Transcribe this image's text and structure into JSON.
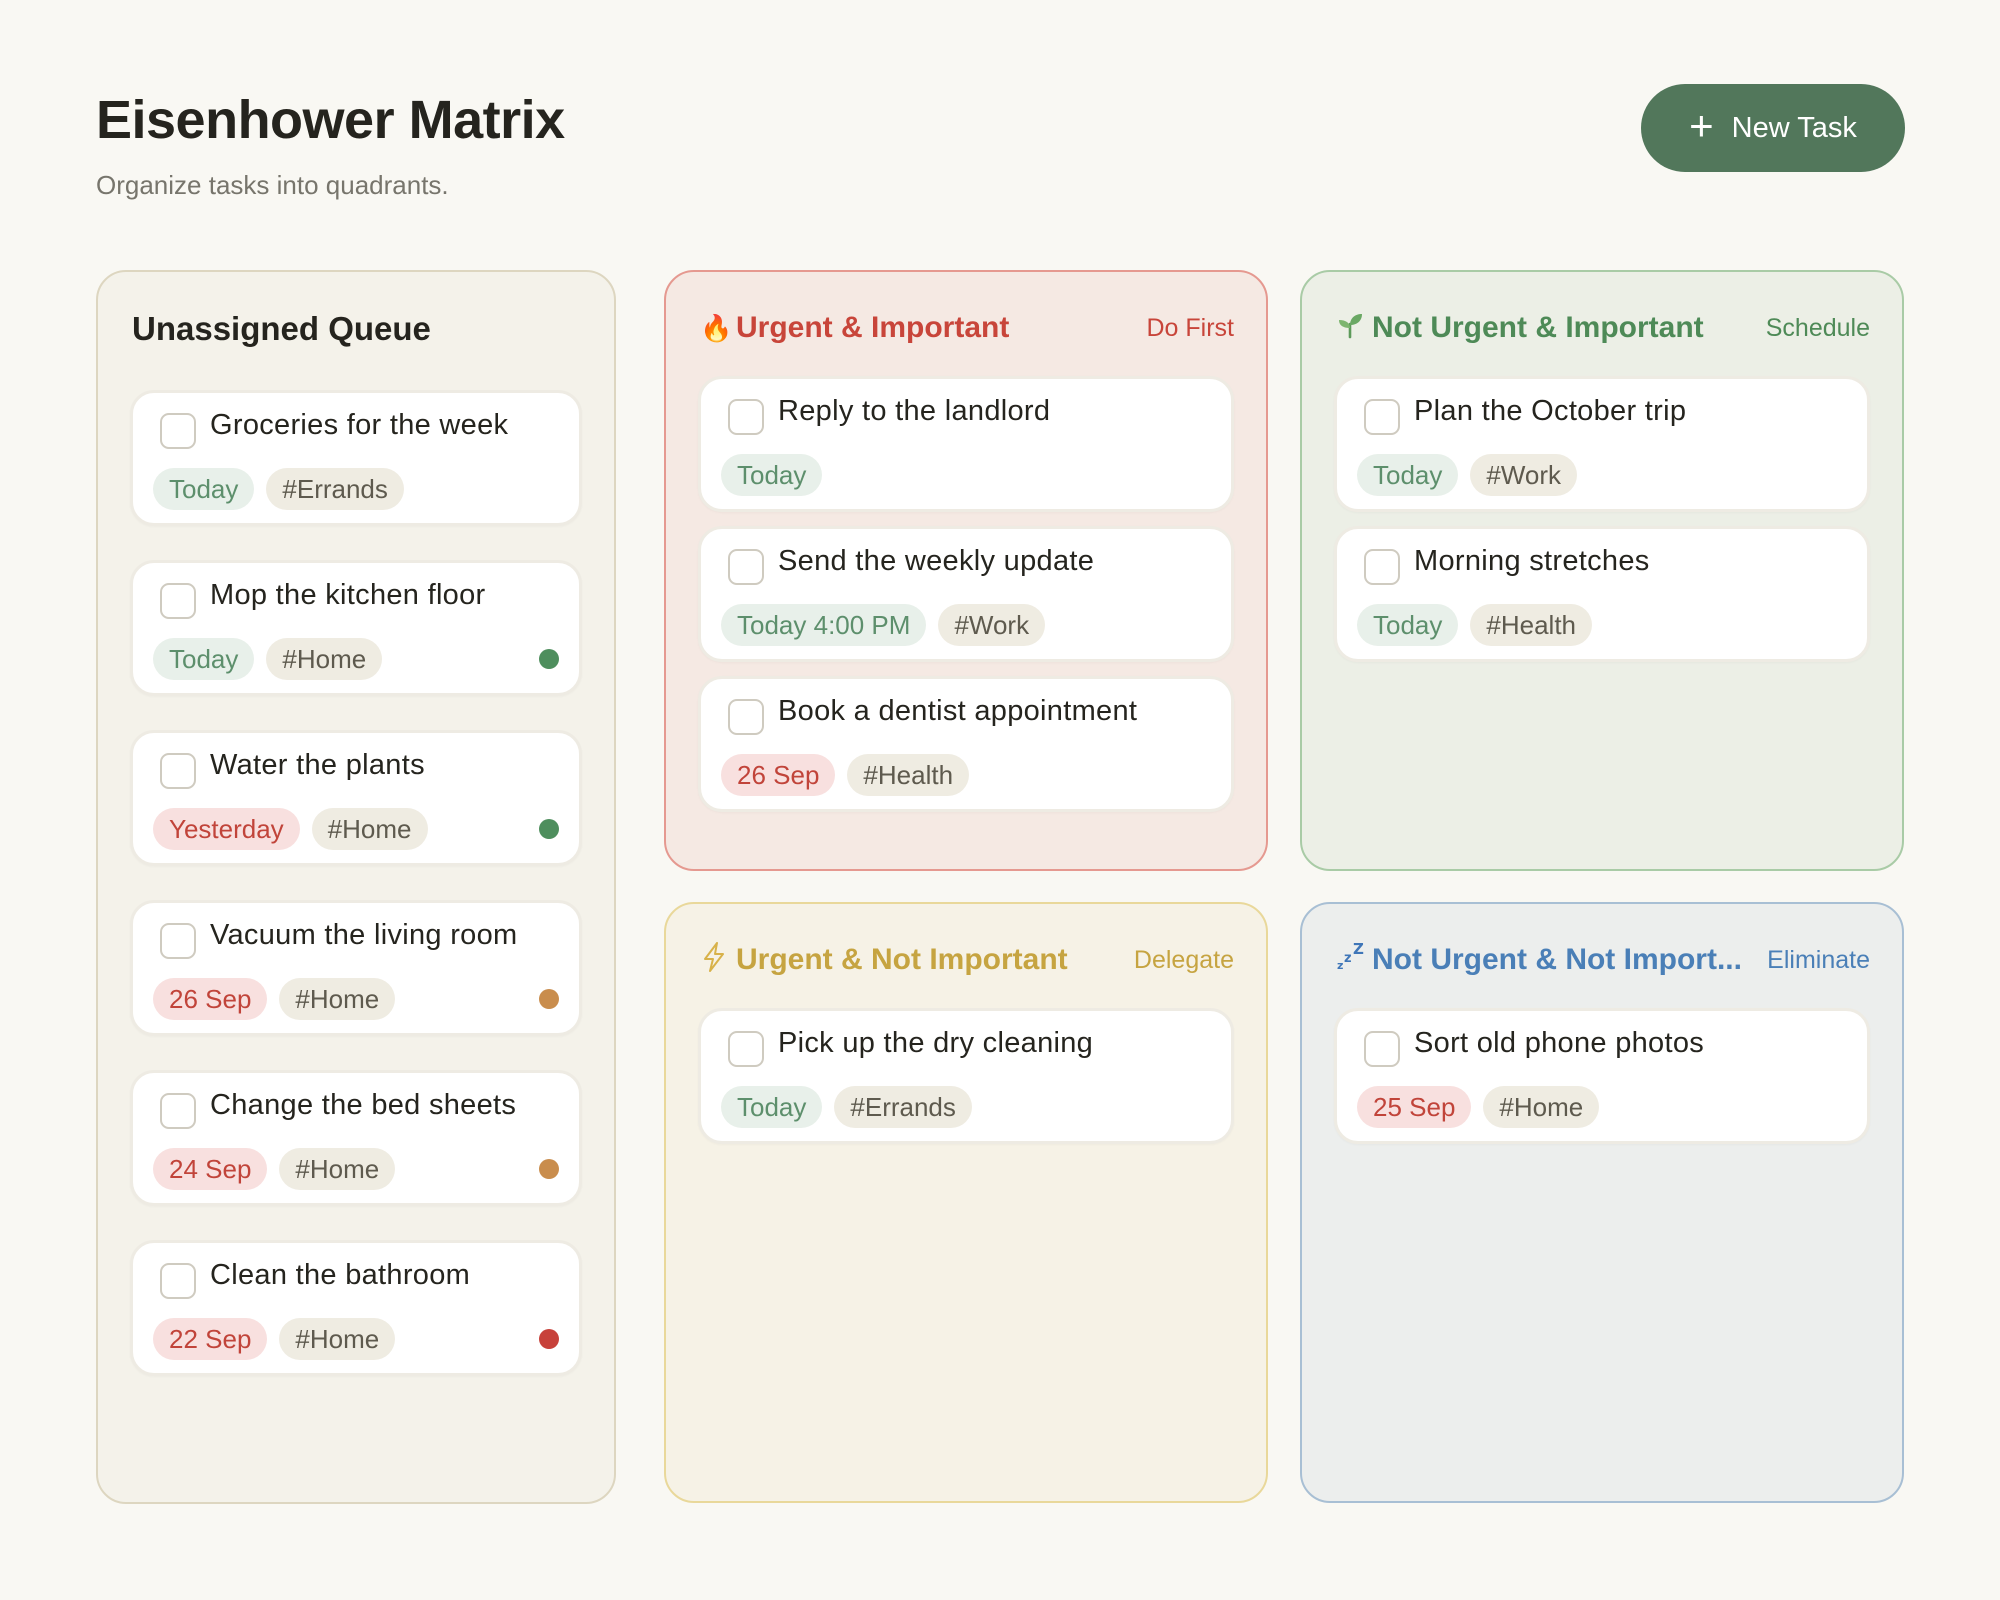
{
  "header": {
    "title": "Eisenhower Matrix",
    "subtitle": "Organize tasks into quadrants.",
    "new_task_label": "New Task"
  },
  "icons": {
    "plus": "plus-icon",
    "do_first": "fire-icon",
    "schedule": "seedling-icon",
    "delegate": "lightning-icon",
    "eliminate": "zzz-sleep-icon"
  },
  "colors": {
    "accent_button": "#52775b",
    "do_first": "#c8453a",
    "schedule": "#4e8a57",
    "delegate": "#c6a441",
    "eliminate": "#4a7fb7",
    "priority_green": "#4e8e5d",
    "priority_orange": "#c98d4d",
    "priority_red": "#c7413a"
  },
  "queue": {
    "title": "Unassigned Queue",
    "tasks": [
      {
        "title": "Groceries for the week",
        "date": "Today",
        "tag": "#Errands"
      },
      {
        "title": "Mop the kitchen floor",
        "date": "Today",
        "tag": "#Home",
        "priority": "green"
      },
      {
        "title": "Water the plants",
        "date": "Yesterday",
        "tag": "#Home",
        "priority": "green"
      },
      {
        "title": "Vacuum the living room",
        "date": "26 Sep",
        "tag": "#Home",
        "priority": "orange"
      },
      {
        "title": "Change the bed sheets",
        "date": "24 Sep",
        "tag": "#Home",
        "priority": "orange"
      },
      {
        "title": "Clean the bathroom",
        "date": "22 Sep",
        "tag": "#Home",
        "priority": "red"
      }
    ]
  },
  "quadrants": {
    "do_first": {
      "title": "Urgent & Important",
      "action": "Do First",
      "tasks": [
        {
          "title": "Reply to the landlord",
          "date": "Today"
        },
        {
          "title": "Send the weekly update",
          "date": "Today 4:00 PM",
          "tag": "#Work"
        },
        {
          "title": "Book a dentist appointment",
          "date": "26 Sep",
          "tag": "#Health"
        }
      ]
    },
    "schedule": {
      "title": "Not Urgent & Important",
      "action": "Schedule",
      "tasks": [
        {
          "title": "Plan the October trip",
          "date": "Today",
          "tag": "#Work"
        },
        {
          "title": "Morning stretches",
          "date": "Today",
          "tag": "#Health"
        }
      ]
    },
    "delegate": {
      "title": "Urgent & Not Important",
      "action": "Delegate",
      "tasks": [
        {
          "title": "Pick up the dry cleaning",
          "date": "Today",
          "tag": "#Errands"
        }
      ]
    },
    "eliminate": {
      "title": "Not Urgent & Not Import...",
      "action": "Eliminate",
      "tasks": [
        {
          "title": "Sort old phone photos",
          "date": "25 Sep",
          "tag": "#Home"
        }
      ]
    }
  }
}
